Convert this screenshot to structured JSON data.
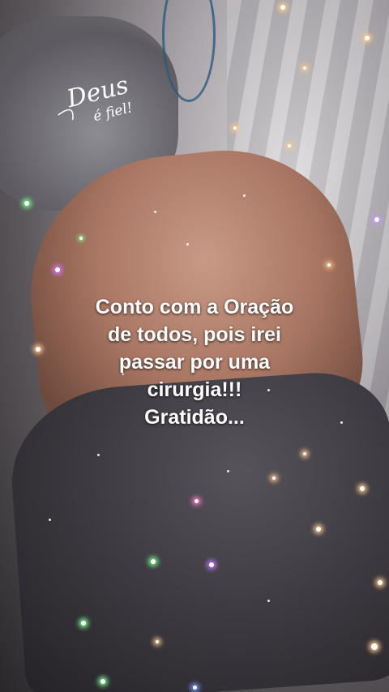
{
  "overlay": {
    "logo_text_line1": "Deus",
    "logo_text_line2": "é fiel!"
  },
  "caption": {
    "lines": [
      "Conto com a Oração",
      "de todos, pois irei",
      "passar por uma",
      "cirurgia!!!",
      "Gratidão..."
    ]
  },
  "colors": {
    "caption_text": "#ffffff",
    "sparkle_glow": "#ffc88c"
  }
}
